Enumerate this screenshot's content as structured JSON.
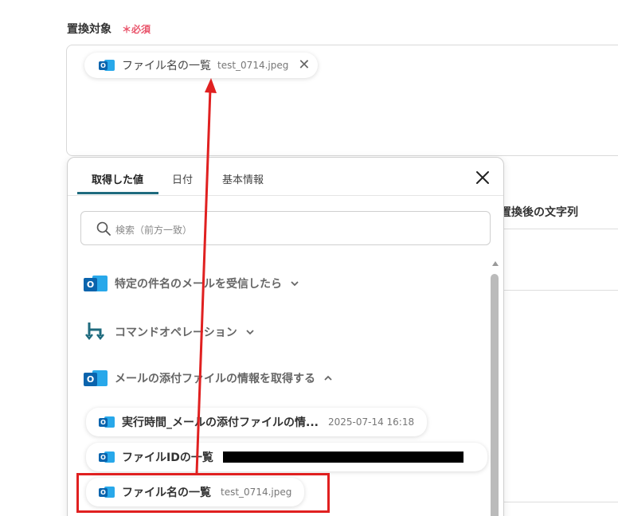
{
  "field": {
    "label": "置換対象",
    "required_mark": "＊必須",
    "selected_chip": {
      "icon": "outlook-icon",
      "label": "ファイル名の一覧",
      "value": "test_0714.jpeg",
      "remove_symbol": "✕"
    }
  },
  "background": {
    "replace_after_label": "置換後の文字列"
  },
  "panel": {
    "tabs": [
      {
        "label": "取得した値",
        "active": true
      },
      {
        "label": "日付",
        "active": false
      },
      {
        "label": "基本情報",
        "active": false
      }
    ],
    "search_placeholder": "検索（前方一致）",
    "groups": [
      {
        "label": "特定の件名のメールを受信したら",
        "icon": "outlook-icon",
        "expanded": false
      },
      {
        "label": "コマンドオペレーション",
        "icon": "command-operation-icon",
        "expanded": false
      },
      {
        "label": "メールの添付ファイルの情報を取得する",
        "icon": "outlook-icon",
        "expanded": true
      }
    ],
    "items": [
      {
        "label": "実行時間_メールの添付ファイルの情...",
        "value": "2025-07-14 16:18"
      },
      {
        "label": "ファイルIDの一覧",
        "value": ""
      },
      {
        "label": "ファイル名の一覧",
        "value": "test_0714.jpeg"
      }
    ]
  },
  "colors": {
    "accent": "#1f6b7e",
    "required": "#e9536a",
    "annotation": "#e02020",
    "outlook_dark": "#0a64ad",
    "outlook_light": "#28a8ea"
  }
}
